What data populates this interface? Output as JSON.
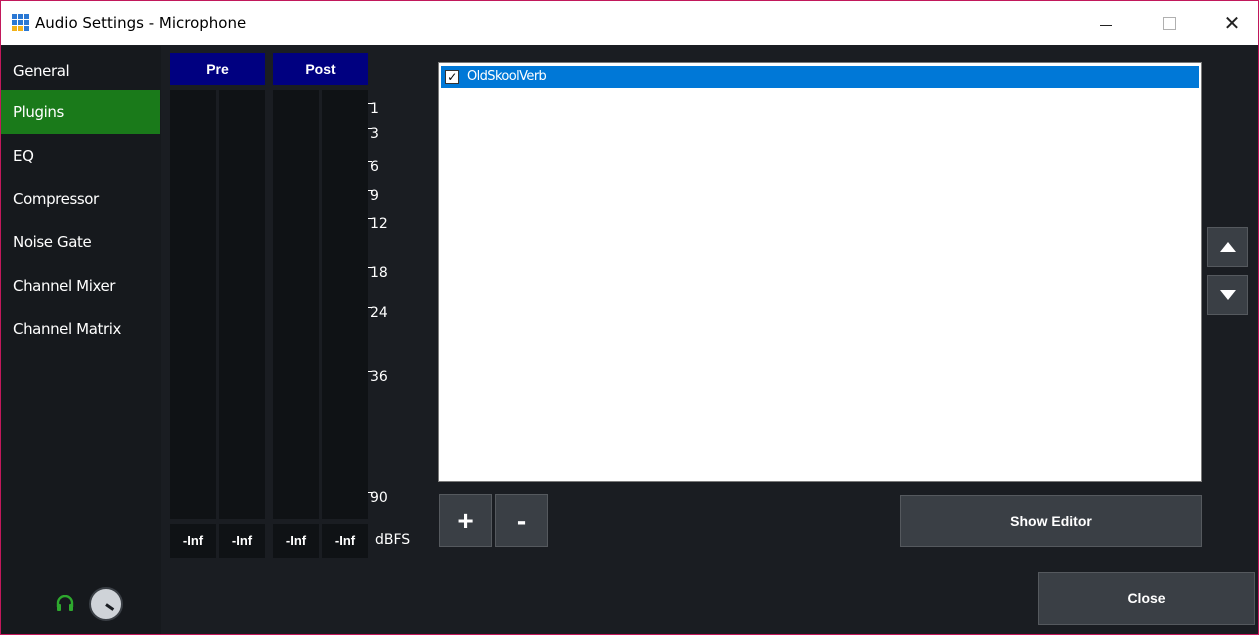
{
  "window": {
    "title": "Audio Settings - Microphone",
    "minimize_icon": "minimize-icon",
    "maximize_icon": "maximize-icon",
    "close_glyph": "✕"
  },
  "sidebar": {
    "items": [
      {
        "label": "General",
        "active": false
      },
      {
        "label": "Plugins",
        "active": true
      },
      {
        "label": "EQ",
        "active": false
      },
      {
        "label": "Compressor",
        "active": false
      },
      {
        "label": "Noise Gate",
        "active": false
      },
      {
        "label": "Channel Mixer",
        "active": false
      },
      {
        "label": "Channel Matrix",
        "active": false
      }
    ]
  },
  "meters": {
    "pre_label": "Pre",
    "post_label": "Post",
    "values": [
      "-Inf",
      "-Inf",
      "-Inf",
      "-Inf"
    ],
    "scale": [
      "1",
      "3",
      "6",
      "9",
      "12",
      "18",
      "24",
      "36",
      "90"
    ],
    "unit": "dBFS"
  },
  "plugins": {
    "items": [
      {
        "name": "OldSkoolVerb",
        "checked": true,
        "selected": true
      }
    ],
    "add_glyph": "+",
    "remove_glyph": "-",
    "show_editor_label": "Show Editor",
    "move_up_icon": "triangle-up-icon",
    "move_down_icon": "triangle-down-icon"
  },
  "footer": {
    "close_label": "Close",
    "headphone_icon": "headphone-icon",
    "knob_icon": "volume-knob-icon"
  },
  "colors": {
    "accent_green": "#1a7a1a",
    "meter_header": "#000080",
    "selection": "#0078d7",
    "background": "#1a1d22",
    "title_border": "#c2185b"
  }
}
